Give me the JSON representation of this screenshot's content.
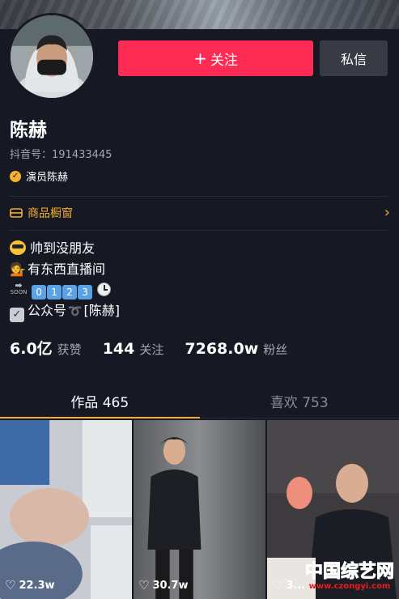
{
  "profile": {
    "name": "陈赫",
    "douyin_id": "抖音号：191433445",
    "verified_title": "演员陈赫"
  },
  "actions": {
    "follow_label": "关注",
    "follow_icon": "+",
    "message_label": "私信"
  },
  "shop": {
    "label": "商品橱窗"
  },
  "bio": {
    "line1": "帅到没朋友",
    "line2": "有东西直播间",
    "soon_label": "SOON",
    "line3_digits": [
      "0",
      "1",
      "2",
      "3"
    ],
    "line4_text": "公众号",
    "line4_name": "[陈赫]"
  },
  "stats": {
    "likes_value": "6.0亿",
    "likes_label": "获赞",
    "following_value": "144",
    "following_label": "关注",
    "fans_value": "7268.0w",
    "fans_label": "粉丝"
  },
  "tabs": {
    "works": "作品 465",
    "liked": "喜欢 753"
  },
  "videos": [
    {
      "likes": "22.3w"
    },
    {
      "likes": "30.7w"
    },
    {
      "likes": "3..."
    }
  ],
  "watermark": {
    "logo": "中国综艺网",
    "url": "www.czongyi.com"
  },
  "colors": {
    "background": "#161823",
    "follow_button": "#fe2c55",
    "message_button": "#393b44",
    "accent_gold": "#f5b12c"
  }
}
